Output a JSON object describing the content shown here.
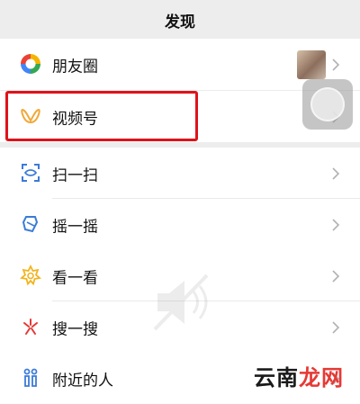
{
  "header": {
    "title": "发现"
  },
  "groups": [
    {
      "items": [
        {
          "label": "朋友圈",
          "icon": "moments-icon",
          "has_thumbnail": true
        }
      ]
    },
    {
      "items": [
        {
          "label": "视频号",
          "icon": "channels-icon",
          "highlighted": true
        }
      ]
    },
    {
      "items": [
        {
          "label": "扫一扫",
          "icon": "scan-icon"
        },
        {
          "label": "摇一摇",
          "icon": "shake-icon"
        }
      ]
    },
    {
      "items": [
        {
          "label": "看一看",
          "icon": "top-stories-icon"
        },
        {
          "label": "搜一搜",
          "icon": "search-icon"
        }
      ]
    },
    {
      "items": [
        {
          "label": "附近的人",
          "icon": "people-nearby-icon"
        }
      ]
    }
  ],
  "watermark": {
    "part1": "云南",
    "part2": "龙网"
  },
  "colors": {
    "background": "#ededed",
    "highlight": "#e0121a",
    "channels": "#f0a93b",
    "scan": "#3b7bd8"
  }
}
